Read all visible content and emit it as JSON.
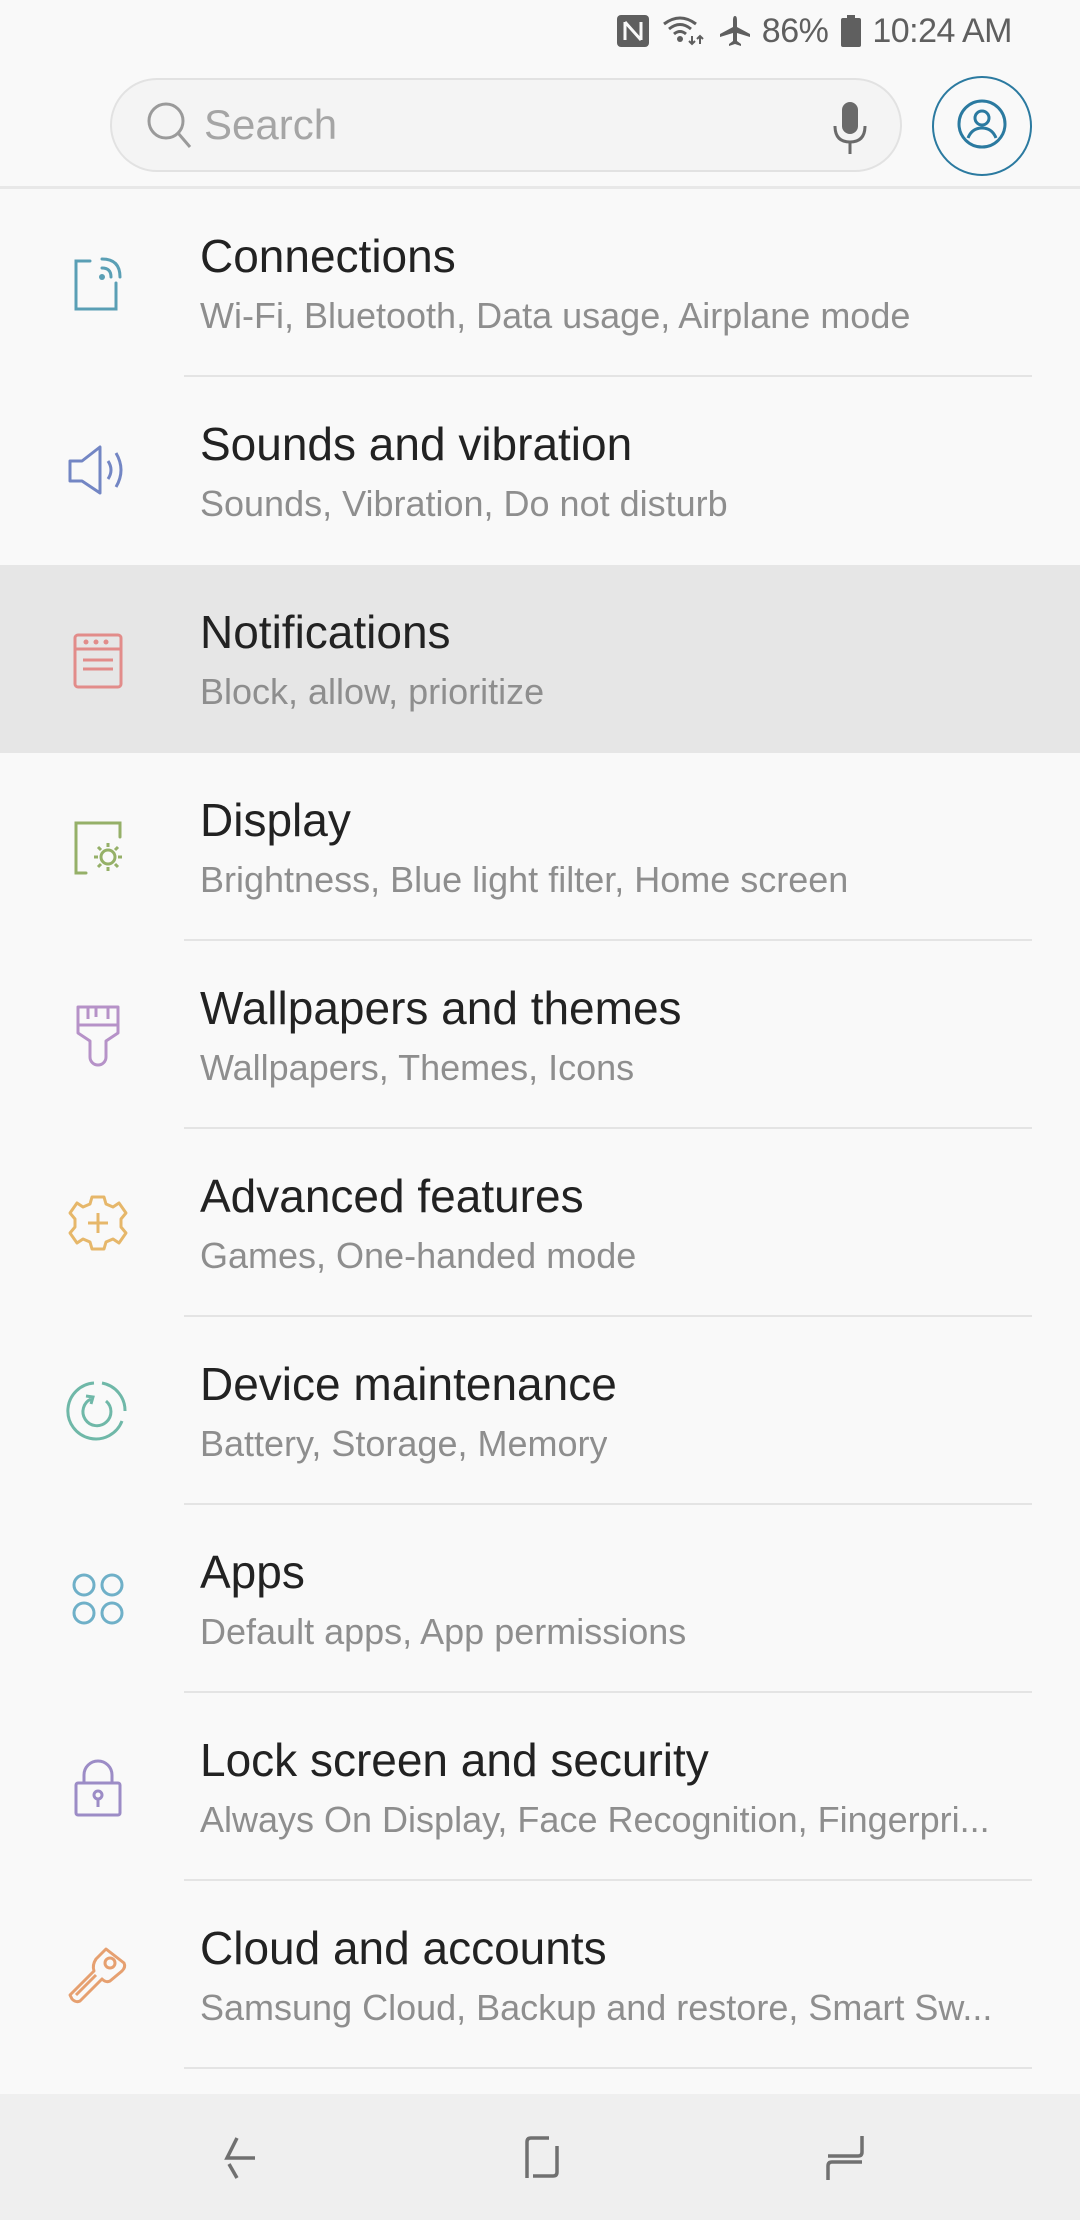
{
  "status_bar": {
    "icons": [
      "nfc-icon",
      "wifi-icon",
      "airplane-mode-icon",
      "battery-icon"
    ],
    "battery_percent": "86%",
    "time": "10:24 AM"
  },
  "search": {
    "placeholder": "Search",
    "value": "",
    "icon": "search-icon",
    "voice_icon": "mic-icon",
    "profile_icon": "account-icon"
  },
  "settings": {
    "items": [
      {
        "title": "Connections",
        "subtitle": "Wi-Fi, Bluetooth, Data usage, Airplane mode",
        "icon": "connections-icon",
        "color": "#5a9fb5"
      },
      {
        "title": "Sounds and vibration",
        "subtitle": "Sounds, Vibration, Do not disturb",
        "icon": "speaker-icon",
        "color": "#7386c4"
      },
      {
        "title": "Notifications",
        "subtitle": "Block, allow, prioritize",
        "icon": "notifications-icon",
        "color": "#e28c8a",
        "highlighted": true
      },
      {
        "title": "Display",
        "subtitle": "Brightness, Blue light filter, Home screen",
        "icon": "display-brightness-icon",
        "color": "#95b068"
      },
      {
        "title": "Wallpapers and themes",
        "subtitle": "Wallpapers, Themes, Icons",
        "icon": "paintbrush-icon",
        "color": "#b692c8"
      },
      {
        "title": "Advanced features",
        "subtitle": "Games, One-handed mode",
        "icon": "gear-plus-icon",
        "color": "#e6b76a"
      },
      {
        "title": "Device maintenance",
        "subtitle": "Battery, Storage, Memory",
        "icon": "refresh-circle-icon",
        "color": "#6fb8a8"
      },
      {
        "title": "Apps",
        "subtitle": "Default apps, App permissions",
        "icon": "apps-grid-icon",
        "color": "#6fb0c8"
      },
      {
        "title": "Lock screen and security",
        "subtitle": "Always On Display, Face Recognition, Fingerpri...",
        "icon": "lock-icon",
        "color": "#9c8cc6"
      },
      {
        "title": "Cloud and accounts",
        "subtitle": "Samsung Cloud, Backup and restore, Smart Sw...",
        "icon": "key-icon",
        "color": "#e6a070"
      }
    ]
  },
  "nav_bar": {
    "back": "back-icon",
    "home": "home-icon",
    "recents": "recents-icon"
  },
  "colors": {
    "accent": "#2b7aa0",
    "highlight_bg": "#e6e6e6",
    "background": "#f9f9f9"
  }
}
